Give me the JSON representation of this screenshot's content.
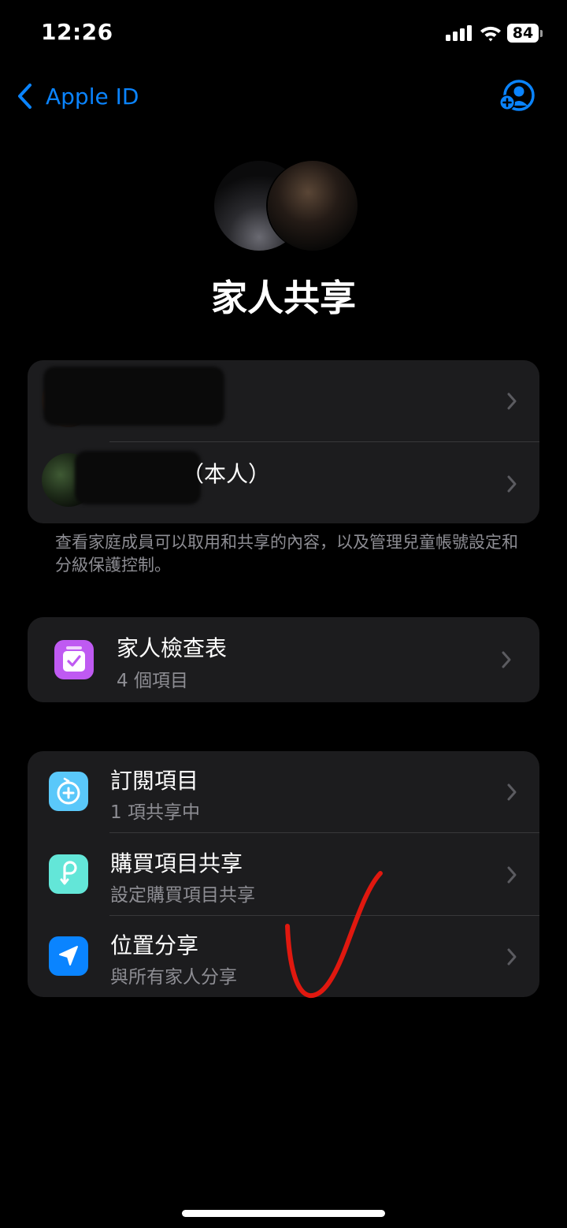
{
  "status_bar": {
    "time": "12:26",
    "battery": "84"
  },
  "nav": {
    "back_label": "Apple ID"
  },
  "page_title": "家人共享",
  "members": [
    {
      "name": "",
      "suffix": ""
    },
    {
      "name": "",
      "suffix": "（本人）"
    }
  ],
  "members_footnote": "查看家庭成員可以取用和共享的內容，以及管理兒童帳號設定和分級保護控制。",
  "checklist": {
    "title": "家人檢查表",
    "subtitle": "4 個項目",
    "icon": "checklist-icon",
    "color": "#bf5af2"
  },
  "features": [
    {
      "title": "訂閱項目",
      "subtitle": "1 項共享中",
      "icon": "subscription-icon",
      "color": "#5ac8fa"
    },
    {
      "title": "購買項目共享",
      "subtitle": "設定購買項目共享",
      "icon": "purchase-sharing-icon",
      "color": "#63e6d8"
    },
    {
      "title": "位置分享",
      "subtitle": "與所有家人分享",
      "icon": "location-arrow-icon",
      "color": "#0a84ff"
    }
  ],
  "colors": {
    "accent": "#0a84ff",
    "card": "#1c1c1e",
    "annotation": "#e0180f"
  }
}
